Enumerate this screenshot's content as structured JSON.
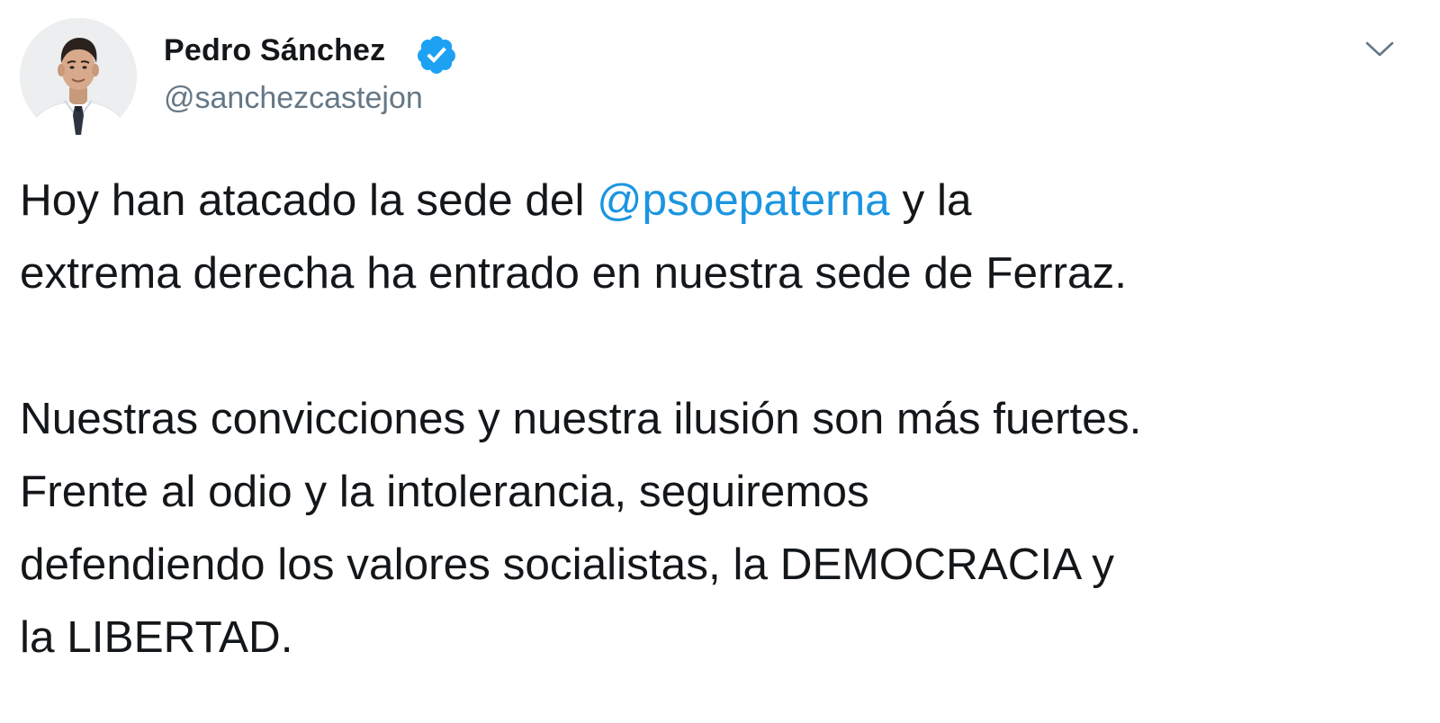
{
  "author": {
    "name": "Pedro Sánchez",
    "handle": "@sanchezcastejon",
    "verified": true,
    "avatar_icon": "profile-photo"
  },
  "menu": {
    "icon": "chevron-down-icon"
  },
  "tweet": {
    "paragraph1": {
      "line1_before": "Hoy han atacado la sede del ",
      "mention": "@psoepaterna",
      "line1_after": " y la",
      "line2": "extrema derecha ha entrado en nuestra sede de Ferraz."
    },
    "paragraph2": {
      "line1": "Nuestras convicciones y nuestra ilusión son más fuertes.",
      "line2": "Frente al odio y la intolerancia, seguiremos",
      "line3": "defendiendo los valores socialistas, la DEMOCRACIA y",
      "line4": "la LIBERTAD."
    }
  },
  "colors": {
    "mention": "#1b95e0",
    "verified": "#1da1f2",
    "handle": "#657786",
    "text": "#14171a"
  }
}
